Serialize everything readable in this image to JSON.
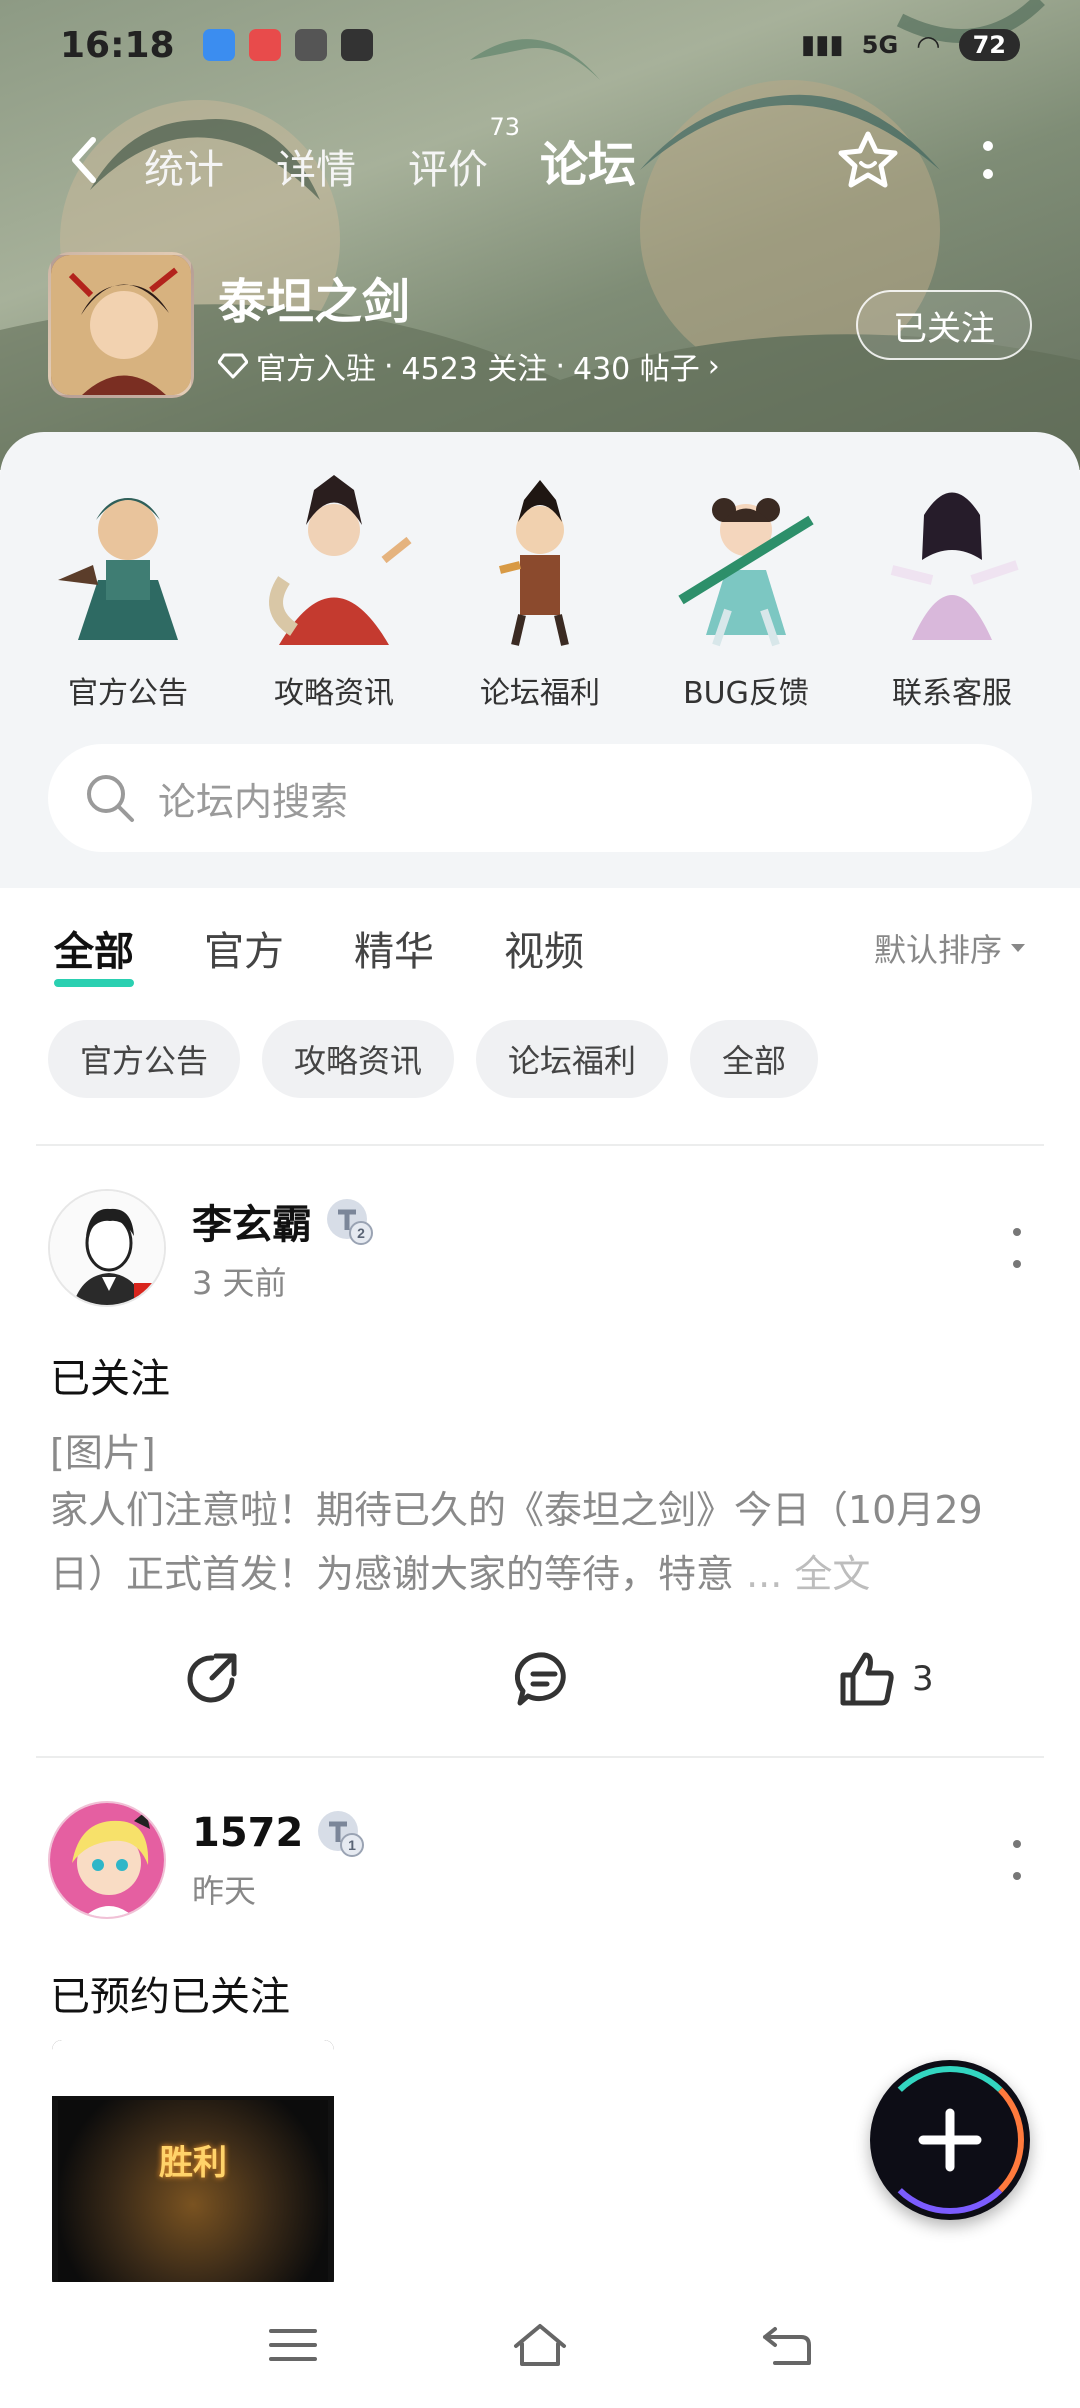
{
  "status": {
    "time": "16:18",
    "signal": "5G",
    "battery": "72"
  },
  "nav": {
    "back_icon": "chevron-left-icon",
    "tabs": [
      {
        "label": "统计"
      },
      {
        "label": "详情"
      },
      {
        "label": "评价",
        "badge": "73"
      },
      {
        "label": "论坛"
      }
    ],
    "active_tab": "论坛"
  },
  "game": {
    "name": "泰坦之剑",
    "badge_icon": "diamond-icon",
    "official": "官方入驻",
    "followers": "4523 关注",
    "posts": "430 帖子",
    "follow_label": "已关注"
  },
  "quick_entries": [
    {
      "label": "官方公告"
    },
    {
      "label": "攻略资讯"
    },
    {
      "label": "论坛福利"
    },
    {
      "label": "BUG反馈"
    },
    {
      "label": "联系客服"
    }
  ],
  "search": {
    "placeholder": "论坛内搜索"
  },
  "filter_tabs": [
    {
      "label": "全部"
    },
    {
      "label": "官方"
    },
    {
      "label": "精华"
    },
    {
      "label": "视频"
    }
  ],
  "sort_label": "默认排序",
  "chips": [
    {
      "label": "官方公告"
    },
    {
      "label": "攻略资讯"
    },
    {
      "label": "论坛福利"
    },
    {
      "label": "全部"
    }
  ],
  "posts": [
    {
      "user": "李玄霸",
      "level": "2",
      "time": "3 天前",
      "title": "已关注",
      "tag": "[图片]",
      "body": "家人们注意啦！期待已久的《泰坦之剑》今日（10月29日）正式首发！为感谢大家的等待，特意",
      "more": " ... 全文",
      "likes": "3"
    },
    {
      "user": "1572",
      "level": "1",
      "time": "昨天",
      "title": "已预约已关注",
      "thumb_text": "胜利"
    }
  ],
  "colors": {
    "accent": "#2ad0b1",
    "text_primary": "#111111",
    "text_muted": "#8a8a8a"
  }
}
